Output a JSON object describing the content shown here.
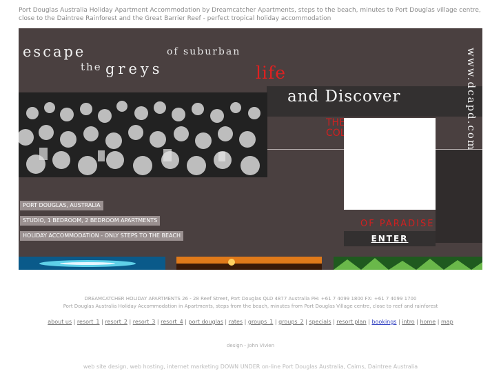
{
  "intro_text": "Port Douglas Australia Holiday Apartment Accommodation by Dreamcatcher Apartments, steps to the beach, minutes to Port Douglas village centre, close to the Daintree Rainforest and the Great Barrier Reef - perfect tropical holiday accommodation",
  "banner": {
    "escape": "escape",
    "the": "the",
    "greys": "greys",
    "of_suburban": "of suburban",
    "life": "life",
    "and_discover": "and Discover",
    "the_colours": "THE COLOURS",
    "of_paradise": "OF PARADISE",
    "url": "www.dcapd.com",
    "enter": "ENTER",
    "tags": [
      "PORT DOUGLAS, AUSTRALIA",
      "STUDIO, 1 BEDROOM, 2 BEDROOM APARTMENTS",
      "HOLIDAY ACCOMMODATION - ONLY STEPS TO THE BEACH"
    ],
    "accent_color": "#d02020",
    "bg_color": "#4a4040"
  },
  "footer": {
    "address": "DREAMCATCHER HOLIDAY APARTMENTS 26 - 28 Reef Street, Port Douglas QLD 4877 Australia PH: +61 7 4099 1800 FX: +61 7 4099 1700",
    "description": "Port Douglas Australia Holiday Accommodation in Apartments, steps from the beach, minutes from Port Douglas Village centre, close to reef and rainforest",
    "nav": [
      "about us",
      "resort_1",
      "resort_2",
      "resort_3",
      "resort_4",
      "port douglas",
      "rates",
      "groups_1",
      "groups_2",
      "specials",
      "resort plan",
      "bookings",
      "intro",
      "home",
      "map"
    ],
    "design_credit": "design - John Vivien",
    "bottom_line": "web site design, web hosting, internet marketing DOWN UNDER on-line Port Douglas Australia, Cairns, Daintree Australia"
  }
}
